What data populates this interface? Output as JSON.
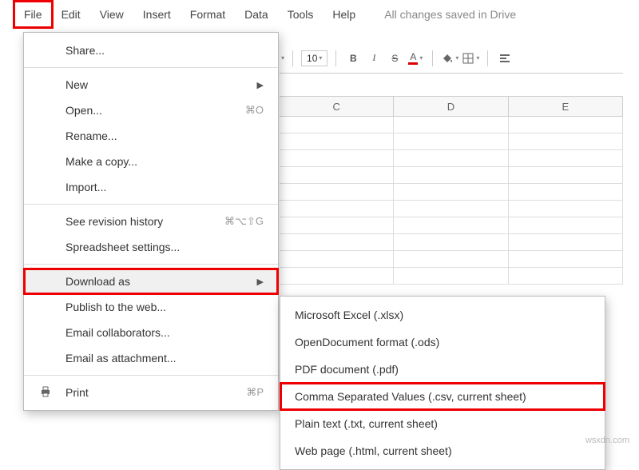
{
  "menubar": {
    "items": [
      "File",
      "Edit",
      "View",
      "Insert",
      "Format",
      "Data",
      "Tools",
      "Help"
    ],
    "status": "All changes saved in Drive"
  },
  "toolbar": {
    "font_size": "10",
    "bold": "B",
    "italic": "I",
    "strike": "S",
    "text_color": "A"
  },
  "columns": [
    "C",
    "D",
    "E"
  ],
  "file_menu": {
    "share": "Share...",
    "new": "New",
    "open": "Open...",
    "open_shortcut": "⌘O",
    "rename": "Rename...",
    "make_copy": "Make a copy...",
    "import": "Import...",
    "revision": "See revision history",
    "revision_shortcut": "⌘⌥⇧G",
    "settings": "Spreadsheet settings...",
    "download_as": "Download as",
    "publish": "Publish to the web...",
    "email_collab": "Email collaborators...",
    "email_attach": "Email as attachment...",
    "print": "Print",
    "print_shortcut": "⌘P"
  },
  "download_submenu": {
    "xlsx": "Microsoft Excel (.xlsx)",
    "ods": "OpenDocument format (.ods)",
    "pdf": "PDF document (.pdf)",
    "csv": "Comma Separated Values (.csv, current sheet)",
    "txt": "Plain text (.txt, current sheet)",
    "html": "Web page (.html, current sheet)"
  },
  "watermark": "wsxdn.com"
}
